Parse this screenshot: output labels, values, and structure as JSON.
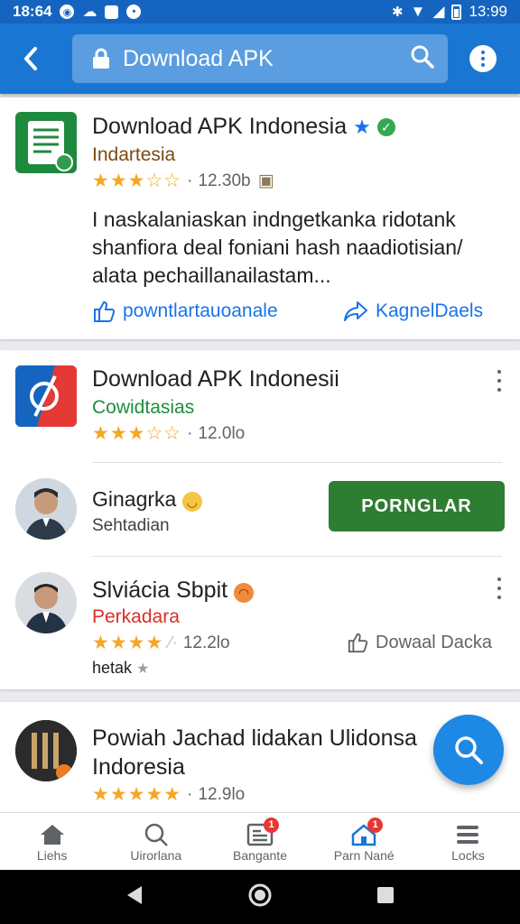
{
  "status_bar": {
    "time_left": "18:64",
    "time_right": "13:99"
  },
  "app_bar": {
    "search_query": "Download APK"
  },
  "card1": {
    "title": "Download APK Indonesia",
    "subtitle": "Indartesia",
    "stars": "★★★☆☆",
    "rating_value": "12.30b",
    "description": "I naskalaniaskan indngetkanka ridotank shanfiora deal foniani hash naadiotisian/ alata pechaillanailastam...",
    "action_left": "powntlartauoanale",
    "action_right": "KagnelDaels"
  },
  "card2": {
    "title": "Download APK Indonesii",
    "subtitle": "Cowidtasias",
    "stars": "★★★☆☆",
    "rating_value": "12.0lo",
    "user1": {
      "name": "Ginagrka",
      "sub": "Sehtadian",
      "button": "PORNGLAR"
    },
    "user2": {
      "name": "Slviácia Sbpit",
      "sub": "Perkadara",
      "stars": "★★★★",
      "rating_value": "12.2lo",
      "action": "Dowaal Dacka",
      "tag": "hetak"
    }
  },
  "card3": {
    "title_line1": "Powiah Jachad lidakan Ulidonsa",
    "title_line2": "Indoresia",
    "stars": "★★★★★",
    "rating_value": "12.9lo"
  },
  "bottom_nav": [
    {
      "label": "Liehs",
      "icon": "home-icon"
    },
    {
      "label": "Uirorlana",
      "icon": "search-icon"
    },
    {
      "label": "Bangante",
      "icon": "news-icon",
      "badge": "1"
    },
    {
      "label": "Parn Nané",
      "icon": "house-icon",
      "badge": "1"
    },
    {
      "label": "Locks",
      "icon": "menu-icon"
    }
  ],
  "colors": {
    "primary": "#1976d2",
    "install_green": "#2e7d32",
    "star": "#f5a623",
    "badge": "#e53935"
  }
}
